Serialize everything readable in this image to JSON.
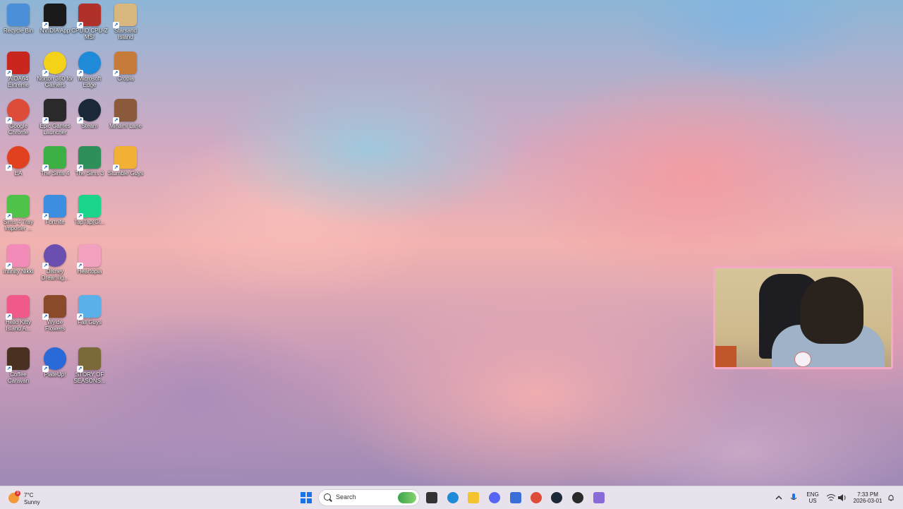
{
  "desktop_icons": [
    {
      "label": "Recycle Bin",
      "icon": "recycle-bin-icon",
      "color": "#4a8fd8"
    },
    {
      "label": "NVIDIA App",
      "icon": "nvidia-icon",
      "color": "#1a1a1a"
    },
    {
      "label": "CPUID CPU-Z MSI",
      "icon": "cpuz-icon",
      "color": "#b0302a"
    },
    {
      "label": "Starsand Island",
      "icon": "starsand-icon",
      "color": "#d9b880"
    },
    {
      "label": "AIDA64 Extreme",
      "icon": "aida64-icon",
      "color": "#c8261e"
    },
    {
      "label": "Norton 360 for Gamers",
      "icon": "norton-icon",
      "color": "#f4d218"
    },
    {
      "label": "Microsoft Edge",
      "icon": "edge-icon",
      "color": "#1f8ad8"
    },
    {
      "label": "Cropia",
      "icon": "cropia-icon",
      "color": "#c77b3a"
    },
    {
      "label": "Google Chrome",
      "icon": "chrome-icon",
      "color": "#dd4b39"
    },
    {
      "label": "Epic Games Launcher",
      "icon": "epic-games-icon",
      "color": "#2a2a2a"
    },
    {
      "label": "Steam",
      "icon": "steam-icon",
      "color": "#1b2838"
    },
    {
      "label": "Minami Lane",
      "icon": "minami-lane-icon",
      "color": "#8a5a3a"
    },
    {
      "label": "EA",
      "icon": "ea-icon",
      "color": "#e2411f"
    },
    {
      "label": "The Sims 4",
      "icon": "sims4-icon",
      "color": "#3cb043"
    },
    {
      "label": "The Sims 3",
      "icon": "sims3-icon",
      "color": "#2f8f5a"
    },
    {
      "label": "Stumble Guys",
      "icon": "stumble-guys-icon",
      "color": "#f2b134"
    },
    {
      "label": "Sims 4 Tray Importer ...",
      "icon": "sims-tray-icon",
      "color": "#4fc24a"
    },
    {
      "label": "Fortnite",
      "icon": "fortnite-icon",
      "color": "#3b8ee0"
    },
    {
      "label": "TapTap(Gl...",
      "icon": "taptap-icon",
      "color": "#19d48a"
    },
    {
      "label": "Infinity Nikki",
      "icon": "infinity-nikki-icon",
      "color": "#f28bb8"
    },
    {
      "label": "Disney Dreamlig...",
      "icon": "disney-dreamlight-icon",
      "color": "#6a4fb0"
    },
    {
      "label": "Heartopia",
      "icon": "heartopia-icon",
      "color": "#f2a0c0"
    },
    {
      "label": "Hello Kitty Island A...",
      "icon": "hello-kitty-icon",
      "color": "#f05a8a"
    },
    {
      "label": "Wylde Flowers",
      "icon": "wylde-flowers-icon",
      "color": "#8a4a2a"
    },
    {
      "label": "Fall Guys",
      "icon": "fall-guys-icon",
      "color": "#5ab0e8"
    },
    {
      "label": "Coffee Caravan",
      "icon": "coffee-caravan-icon",
      "color": "#4a3020"
    },
    {
      "label": "PlateUp!",
      "icon": "plateup-icon",
      "color": "#2a6ad8"
    },
    {
      "label": "STORY OF SEASONS...",
      "icon": "story-of-seasons-icon",
      "color": "#7a6a3a"
    }
  ],
  "taskbar": {
    "weather_temp": "7°C",
    "weather_desc": "Sunny",
    "weather_badge": "3",
    "search_placeholder": "Search",
    "pinned": [
      {
        "name": "windows-start-icon",
        "color": "#1a73e8"
      },
      {
        "name": "task-view-icon",
        "color": "#333333"
      },
      {
        "name": "edge-icon",
        "color": "#1f8ad8"
      },
      {
        "name": "file-explorer-icon",
        "color": "#f4c430"
      },
      {
        "name": "discord-icon",
        "color": "#5865f2"
      },
      {
        "name": "microsoft-store-icon",
        "color": "#3a6fd8"
      },
      {
        "name": "chrome-icon",
        "color": "#dd4b39"
      },
      {
        "name": "steam-icon",
        "color": "#1b2838"
      },
      {
        "name": "app-icon",
        "color": "#2a2a2a"
      },
      {
        "name": "feather-app-icon",
        "color": "#8a6ad8"
      }
    ],
    "lang_line1": "ENG",
    "lang_line2": "US",
    "time": "7:33 PM",
    "date": "2026-03-01"
  }
}
